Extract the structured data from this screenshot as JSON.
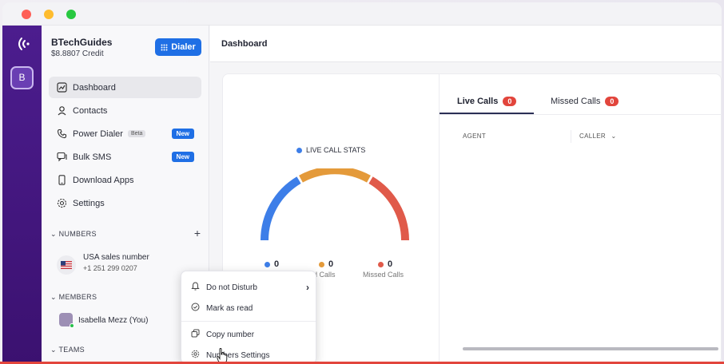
{
  "account": {
    "name": "BTechGuides",
    "credit": "$8.8807 Credit",
    "dialer_label": "Dialer"
  },
  "rail": {
    "workspace_initial": "B"
  },
  "nav": [
    {
      "label": "Dashboard",
      "icon": "dashboard-icon"
    },
    {
      "label": "Contacts",
      "icon": "contacts-icon"
    },
    {
      "label": "Power Dialer",
      "icon": "phone-icon",
      "tag": "Beta",
      "badge": "New"
    },
    {
      "label": "Bulk SMS",
      "icon": "sms-icon",
      "badge": "New"
    },
    {
      "label": "Download Apps",
      "icon": "mobile-icon"
    },
    {
      "label": "Settings",
      "icon": "gear-icon"
    }
  ],
  "numbers": {
    "heading": "NUMBERS",
    "name": "USA sales number",
    "phone": "+1 251 299 0207"
  },
  "members": {
    "heading": "MEMBERS",
    "name": "Isabella Mezz (You)"
  },
  "teams": {
    "heading": "TEAMS"
  },
  "header": {
    "title": "Dashboard"
  },
  "stats": {
    "legend": "LIVE CALL STATS",
    "items": [
      {
        "value": "0",
        "label": "",
        "color": "#3d7ee8"
      },
      {
        "value": "0",
        "label": "ssed Calls",
        "color": "#e49a3a"
      },
      {
        "value": "0",
        "label": "Missed Calls",
        "color": "#e05a4a"
      }
    ]
  },
  "tabs": [
    {
      "label": "Live Calls",
      "count": "0"
    },
    {
      "label": "Missed Calls",
      "count": "0"
    }
  ],
  "columns": {
    "agent": "AGENT",
    "caller": "CALLER"
  },
  "context_menu": {
    "items": [
      "Do not Disturb",
      "Mark as read",
      "Copy number",
      "Numbers Settings"
    ]
  },
  "colors": {
    "accent": "#1f6fe5",
    "rail": "#4c1d8e",
    "badge_red": "#e2453c"
  }
}
